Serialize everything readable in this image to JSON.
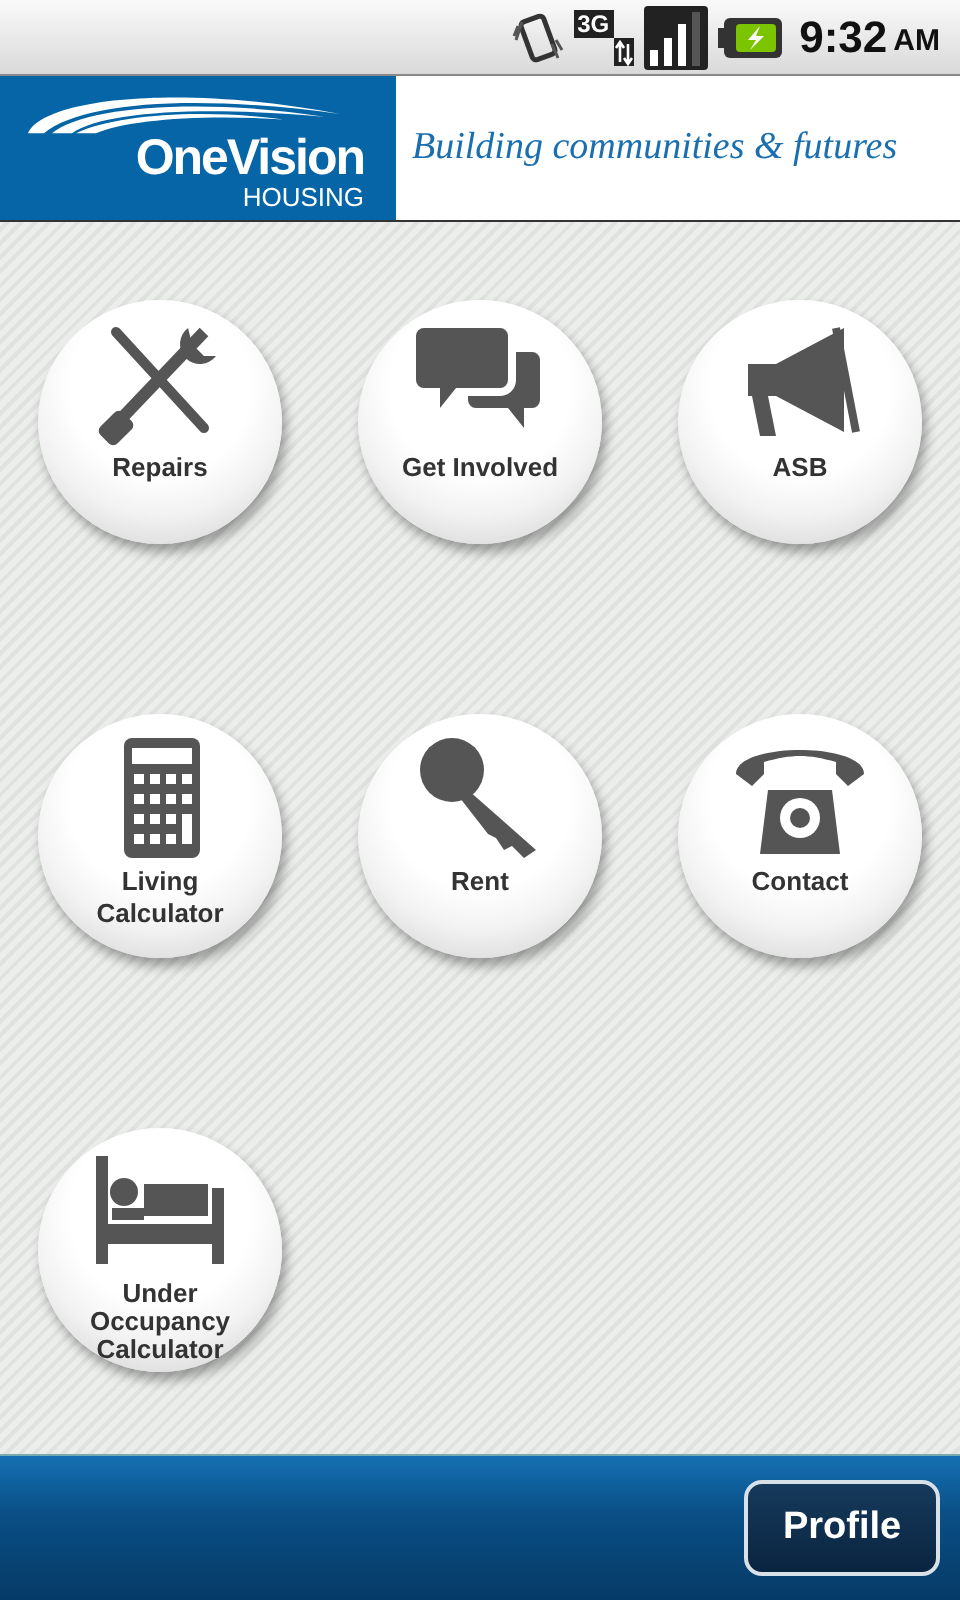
{
  "status_bar": {
    "network": "3G",
    "time": "9:32",
    "period": "AM"
  },
  "header": {
    "brand": "OneVision",
    "brand_sub": "HOUSING",
    "tagline": "Building communities & futures"
  },
  "tiles": [
    {
      "label": "Repairs"
    },
    {
      "label": "Get Involved"
    },
    {
      "label": "ASB"
    },
    {
      "label": "Living Calculator"
    },
    {
      "label": "Rent"
    },
    {
      "label": "Contact"
    },
    {
      "label": "Under Occupancy Calculator"
    }
  ],
  "bottom_bar": {
    "button": "Profile"
  }
}
